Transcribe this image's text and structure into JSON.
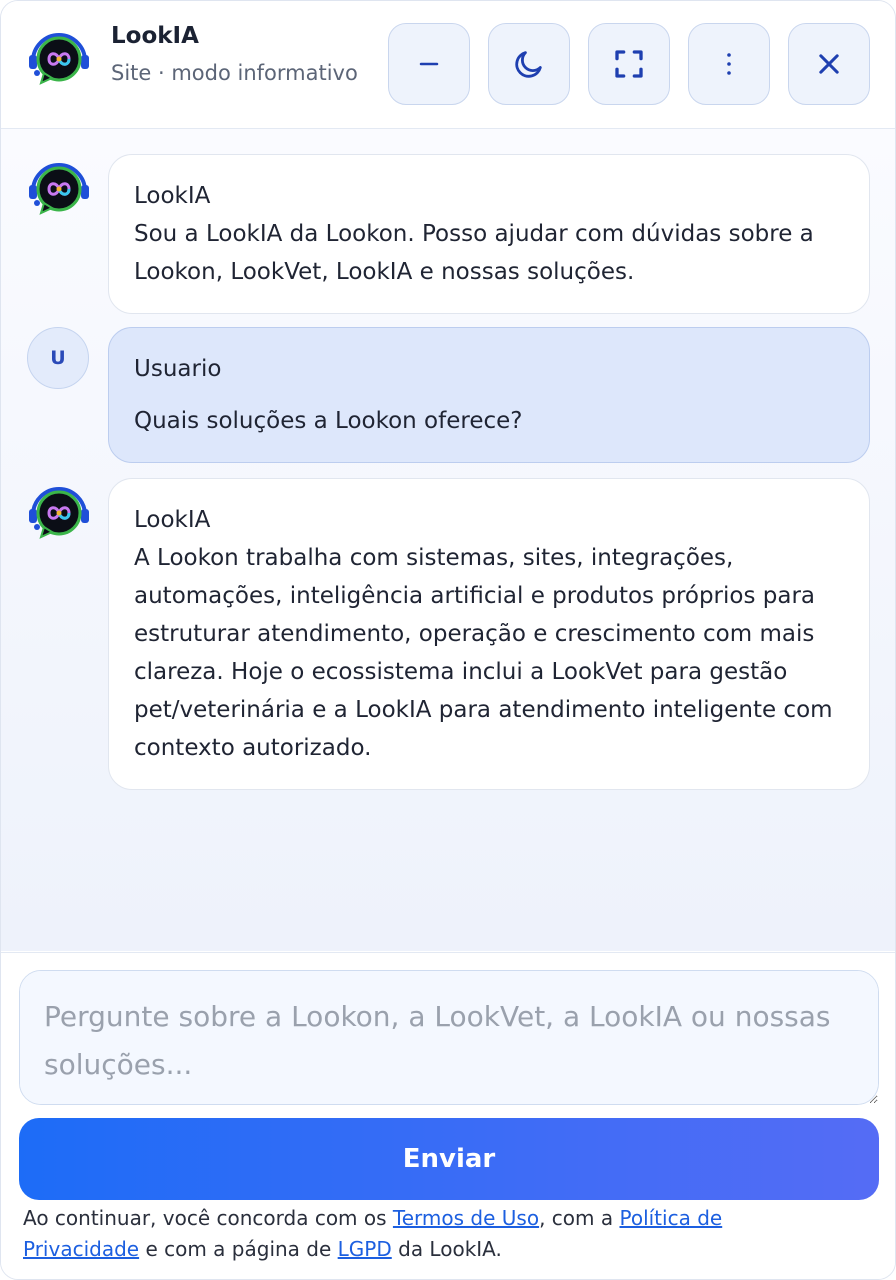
{
  "header": {
    "title": "LookIA",
    "subtitle": "Site · modo informativo",
    "buttons": [
      {
        "name": "minimize-button",
        "icon": "minus-icon"
      },
      {
        "name": "theme-toggle-button",
        "icon": "moon-icon"
      },
      {
        "name": "fullscreen-button",
        "icon": "expand-icon"
      },
      {
        "name": "menu-button",
        "icon": "vertical-dots-icon"
      },
      {
        "name": "close-button",
        "icon": "close-icon"
      }
    ]
  },
  "messages": [
    {
      "role": "bot",
      "author": "LookIA",
      "text": "Sou a LookIA da Lookon. Posso ajudar com dúvidas sobre a Lookon, LookVet, LookIA e nossas soluções."
    },
    {
      "role": "user",
      "avatar_letter": "U",
      "author": "Usuario",
      "text": "Quais soluções a Lookon oferece?"
    },
    {
      "role": "bot",
      "author": "LookIA",
      "text": "A Lookon trabalha com sistemas, sites, integrações, automações, inteligência artificial e produtos próprios para estruturar atendimento, operação e crescimento com mais clareza. Hoje o ecossistema inclui a LookVet para gestão pet/veterinária e a LookIA para atendimento inteligente com contexto autorizado."
    }
  ],
  "composer": {
    "placeholder": "Pergunte sobre a Lookon, a LookVet, a LookIA ou nossas soluções...",
    "value": "",
    "send_label": "Enviar"
  },
  "legal": {
    "prefix": "Ao continuar, você concorda com os ",
    "terms_link": "Termos de Uso",
    "middle": ", com a ",
    "privacy_link": "Política de Privacidade",
    "middle2": " e com a página de ",
    "lgpd_link": "LGPD",
    "suffix": " da LookIA."
  },
  "colors": {
    "accent": "#1d6cf7",
    "accent_end": "#556cf5",
    "user_bubble": "#dde7fb",
    "header_button_bg": "#eef3fc",
    "icon_color": "#1e3fb0"
  }
}
